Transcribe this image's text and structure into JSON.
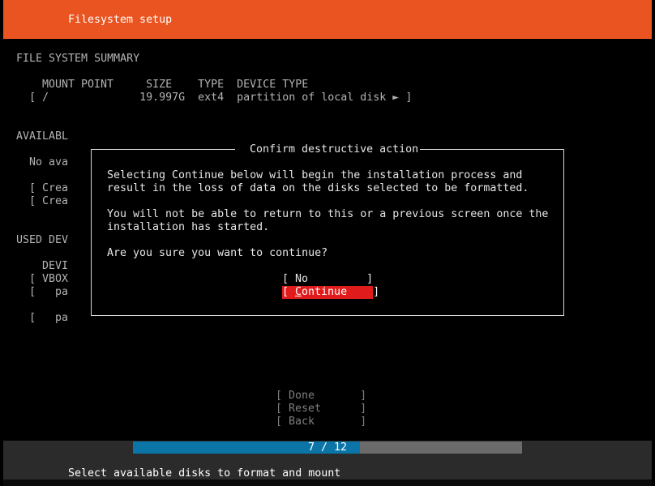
{
  "header": {
    "title": "Filesystem setup"
  },
  "summary": {
    "heading": "FILE SYSTEM SUMMARY",
    "columns_line": "MOUNT POINT     SIZE    TYPE  DEVICE TYPE",
    "row_line": "[ /              19.997G  ext4  partition of local disk ► ]"
  },
  "available": {
    "heading": "AVAILABL",
    "no_avail": "No ava",
    "item1": "[ Crea",
    "item2": "[ Crea"
  },
  "used": {
    "heading": "USED DEV",
    "col": "DEVI",
    "row1": "[ VBOX",
    "row2": "[   pa",
    "row3": "[   pa"
  },
  "dialog": {
    "title": " Confirm destructive action ",
    "line1": "Selecting Continue below will begin the installation process and",
    "line2": "result in the loss of data on the disks selected to be formatted.",
    "line3": "You will not be able to return to this or a previous screen once the",
    "line4": "installation has started.",
    "question": "Are you sure you want to continue?",
    "no_button": "[ No         ]",
    "continue_prefix": "[ ",
    "continue_cursor": "C",
    "continue_rest": "ontinue    ]"
  },
  "buttons": {
    "done": "[ Done       ]",
    "reset": "[ Reset      ]",
    "back": "[ Back       ]"
  },
  "progress": {
    "label": "7 / 12",
    "fraction": 0.583
  },
  "footer": {
    "hint": "Select available disks to format and mount"
  }
}
